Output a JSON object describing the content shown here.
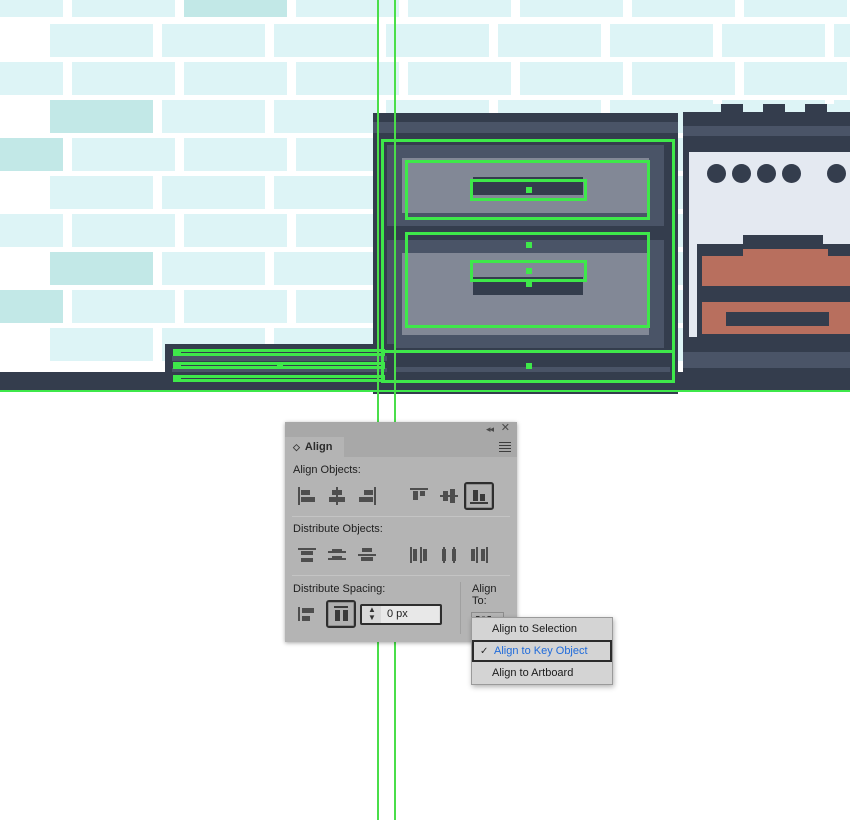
{
  "app": {
    "name": "vector-editor-canvas"
  },
  "panel": {
    "title": "Align",
    "tab_grip_icon": "grip-icon",
    "collapse_icon": "collapse-icon",
    "collapse_glyph": "◂◂",
    "close_icon": "close-icon",
    "close_glyph": "✕",
    "menu_icon": "panel-menu-icon",
    "sections": {
      "align_objects_label": "Align Objects:",
      "distribute_objects_label": "Distribute Objects:",
      "distribute_spacing_label": "Distribute Spacing:",
      "align_to_label": "Align To:"
    },
    "align_objects_buttons": [
      {
        "name": "align-left-button",
        "icon": "align-horizontal-left-icon",
        "active": false
      },
      {
        "name": "align-horizontal-center-button",
        "icon": "align-horizontal-center-icon",
        "active": false
      },
      {
        "name": "align-right-button",
        "icon": "align-horizontal-right-icon",
        "active": false
      },
      {
        "name": "align-top-button",
        "icon": "align-vertical-top-icon",
        "active": false
      },
      {
        "name": "align-vertical-center-button",
        "icon": "align-vertical-center-icon",
        "active": false
      },
      {
        "name": "align-bottom-button",
        "icon": "align-vertical-bottom-icon",
        "active": true
      }
    ],
    "distribute_objects_buttons": [
      {
        "name": "distribute-vertical-top-button",
        "icon": "distribute-vertical-top-icon",
        "active": false
      },
      {
        "name": "distribute-vertical-center-button",
        "icon": "distribute-vertical-center-icon",
        "active": false
      },
      {
        "name": "distribute-vertical-bottom-button",
        "icon": "distribute-vertical-bottom-icon",
        "active": false
      },
      {
        "name": "distribute-horizontal-left-button",
        "icon": "distribute-horizontal-left-icon",
        "active": false
      },
      {
        "name": "distribute-horizontal-center-button",
        "icon": "distribute-horizontal-center-icon",
        "active": false
      },
      {
        "name": "distribute-horizontal-right-button",
        "icon": "distribute-horizontal-right-icon",
        "active": false
      }
    ],
    "distribute_spacing_buttons": [
      {
        "name": "distribute-vertical-spacing-button",
        "icon": "vertical-spacing-icon",
        "active": false
      },
      {
        "name": "distribute-horizontal-spacing-button",
        "icon": "horizontal-spacing-icon",
        "active": true
      }
    ],
    "spacing_value": "0 px",
    "spacing_placeholder": "0 px",
    "stepper_icon": "stepper-arrows-icon",
    "align_to_button": {
      "name": "align-to-dropdown-button",
      "icon": "align-to-key-object-icon",
      "chevron": "chevron-down-icon",
      "chevron_glyph": "⌄"
    }
  },
  "dropdown": {
    "items": [
      {
        "label": "Align to Selection",
        "selected": false,
        "checked": false
      },
      {
        "label": "Align to Key Object",
        "selected": true,
        "checked": true
      },
      {
        "label": "Align to Artboard",
        "selected": false,
        "checked": false
      }
    ],
    "check_glyph": "✓"
  },
  "colors": {
    "selection_green": "#3ee84a",
    "guide_green": "#4ade4a",
    "tile_light": "#ddf4f6",
    "tile_dark": "#c2e8e7",
    "cabinet_dark": "#343d4d",
    "cabinet_mid": "#4a5467",
    "cabinet_light": "#828896",
    "stove_panel": "#e4e9f1",
    "coil": "#b86f5e",
    "panel_bg": "#b4b4b4",
    "link_blue": "#1f6bdb"
  },
  "artwork": {
    "description": "kitchen-illustration",
    "guides": {
      "vertical_x": [
        377,
        394
      ],
      "horizontal_y": [
        391
      ]
    }
  }
}
